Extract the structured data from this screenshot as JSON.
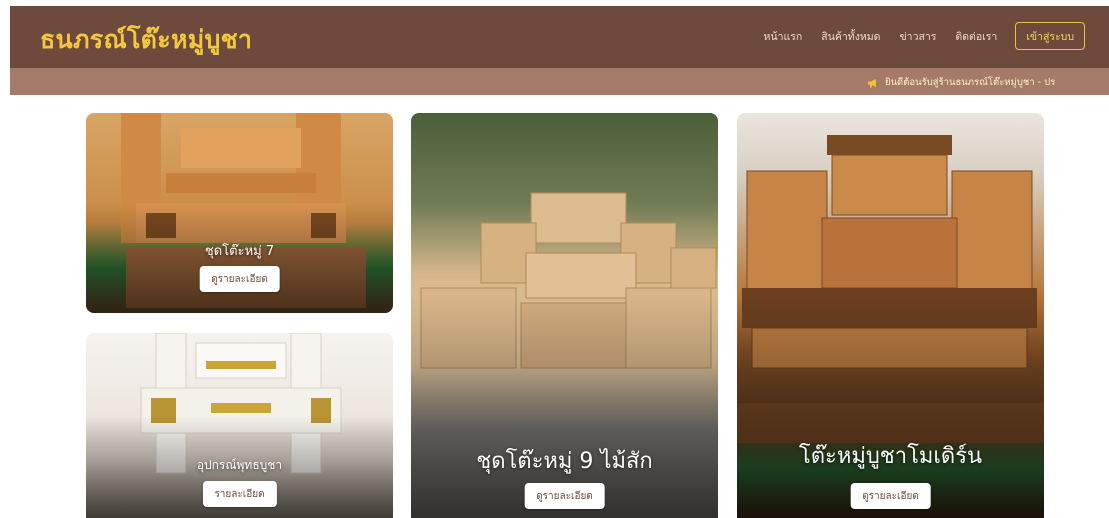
{
  "header": {
    "brand": "ธนภรณ์โต๊ะหมู่บูชา",
    "nav": [
      {
        "label": "หน้าแรก"
      },
      {
        "label": "สินค้าทั้งหมด"
      },
      {
        "label": "ข่าวสาร"
      },
      {
        "label": "ติดต่อเรา"
      }
    ],
    "login_label": "เข้าสู่ระบบ"
  },
  "ticker": {
    "icon": "megaphone-icon",
    "text": "ยินดีต้อนรับสู่ร้านธนภรณ์โต๊ะหมู่บูชา - ปร"
  },
  "products": [
    {
      "title": "ชุดโต๊ะหมู่ 7",
      "button": "ดูรายละเอียด"
    },
    {
      "title": "อุปกรณ์พุทธบูชา",
      "button": "รายละเอียด"
    },
    {
      "title": "ชุดโต๊ะหมู่ 9 ไม้สัก",
      "button": "ดูรายละเอียด"
    },
    {
      "title": "โต๊ะหมู่บูชาโมเดิร์น",
      "button": "ดูรายละเอียด"
    }
  ],
  "colors": {
    "navbar": "#6d4a3b",
    "ticker": "#a57a69",
    "brand": "#f3c83c"
  }
}
